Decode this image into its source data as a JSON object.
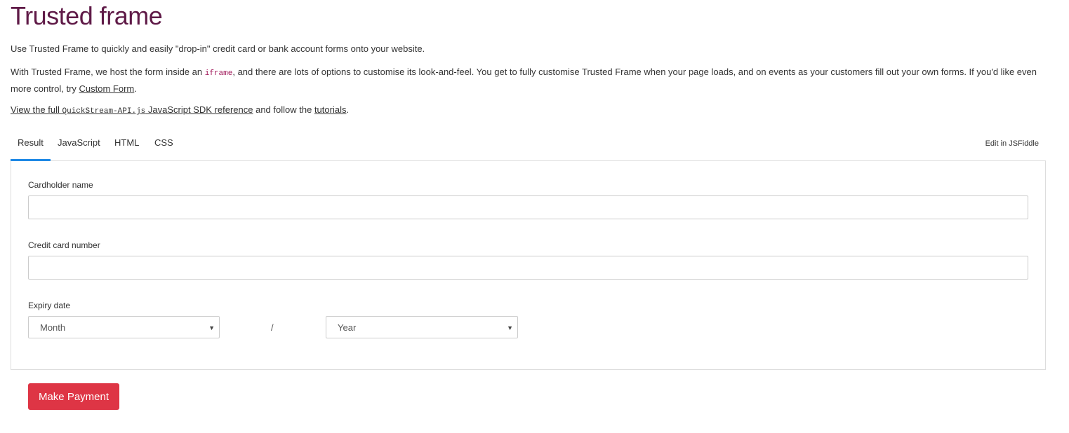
{
  "page": {
    "title": "Trusted frame",
    "intro": "Use Trusted Frame to quickly and easily \"drop-in\" credit card or bank account forms onto your website.",
    "para2_a": "With Trusted Frame, we host the form inside an ",
    "para2_code": "iframe",
    "para2_b": ", and there are lots of options to customise its look-and-feel. You get to fully customise Trusted Frame when your page loads, and on events as your customers fill out your own forms. If you'd like even more control, try ",
    "para2_link": "Custom Form",
    "para2_end": ".",
    "para3_link_a": "View the full ",
    "para3_code": "QuickStream-API.js",
    "para3_link_b": " JavaScript SDK reference",
    "para3_mid": " and follow the ",
    "para3_link2": "tutorials",
    "para3_end": "."
  },
  "tabs": [
    {
      "label": "Result",
      "active": true
    },
    {
      "label": "JavaScript"
    },
    {
      "label": "HTML"
    },
    {
      "label": "CSS"
    }
  ],
  "edit_link": "Edit in JSFiddle",
  "form": {
    "cardholder_label": "Cardholder name",
    "cardholder_value": "",
    "card_number_label": "Credit card number",
    "card_number_value": "",
    "expiry_label": "Expiry date",
    "month_value": "Month",
    "separator": "/",
    "year_value": "Year"
  },
  "submit_label": "Make Payment",
  "colors": {
    "title": "#5f1a47",
    "tab_active": "#1e88e5",
    "button": "#de3545"
  }
}
